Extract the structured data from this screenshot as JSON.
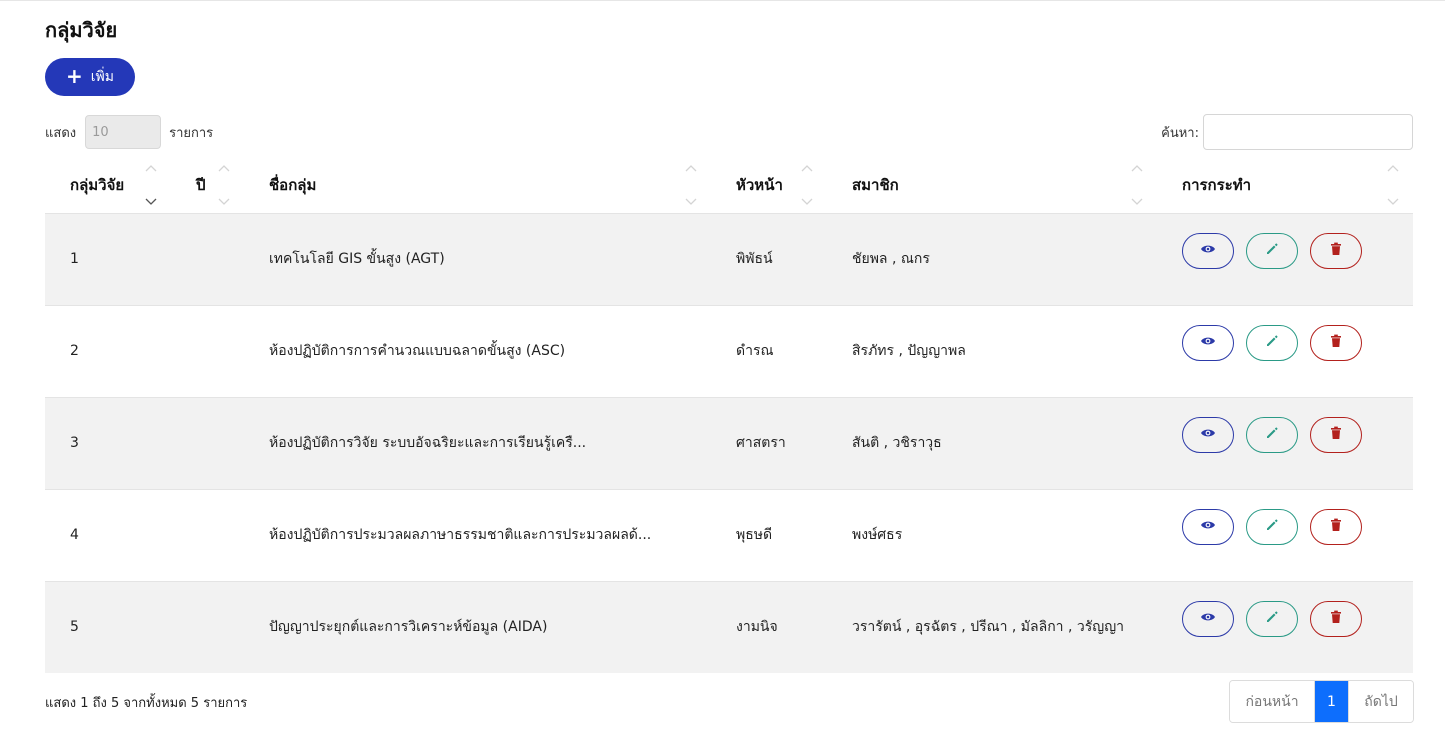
{
  "page": {
    "title": "กลุ่มวิจัย"
  },
  "toolbar": {
    "add_label": "เพิ่ม"
  },
  "length_control": {
    "prefix": "แสดง",
    "value": "10",
    "suffix": "รายการ"
  },
  "search": {
    "label": "ค้นหา:",
    "value": ""
  },
  "table": {
    "columns": [
      "กลุ่มวิจัย",
      "ปี",
      "ชื่อกลุ่ม",
      "หัวหน้า",
      "สมาชิก",
      "การกระทำ"
    ],
    "sorted_column": "กลุ่มวิจัย",
    "sort_direction": "descending",
    "rows": [
      {
        "id": "1",
        "year": "",
        "name": "เทคโนโลยี GIS ขั้นสูง (AGT)",
        "head": "พิพัธน์",
        "members": "ชัยพล , ณกร"
      },
      {
        "id": "2",
        "year": "",
        "name": "ห้องปฏิบัติการการคำนวณแบบฉลาดขั้นสูง (ASC)",
        "head": "ดำรณ",
        "members": "สิรภัทร , ปัญญาพล"
      },
      {
        "id": "3",
        "year": "",
        "name": "ห้องปฏิบัติการวิจัย ระบบอัจฉริยะและการเรียนรู้เครื...",
        "head": "ศาสตรา",
        "members": "สันติ , วชิราวุธ"
      },
      {
        "id": "4",
        "year": "",
        "name": "ห้องปฏิบัติการประมวลผลภาษาธรรมชาติและการประมวลผลด้...",
        "head": "พุธษดี",
        "members": "พงษ์ศธร"
      },
      {
        "id": "5",
        "year": "",
        "name": "ปัญญาประยุกต์และการวิเคราะห์ข้อมูล (AIDA)",
        "head": "งามนิจ",
        "members": "วรารัตน์ , อุรฉัตร , ปรีณา , มัลลิกา , วรัญญา"
      }
    ],
    "actions": {
      "view_icon": "eye-icon",
      "edit_icon": "pencil-icon",
      "delete_icon": "trash-icon"
    }
  },
  "footer": {
    "info": "แสดง 1 ถึง 5 จากทั้งหมด 5 รายการ",
    "pagination": {
      "prev": "ก่อนหน้า",
      "current": "1",
      "next": "ถัดไป"
    }
  },
  "colors": {
    "primary": "#2438b8",
    "view": "#2c3aa8",
    "edit": "#2a9a86",
    "delete": "#b3211d",
    "active_page": "#0d6efd",
    "striped_row": "#f2f2f2"
  }
}
